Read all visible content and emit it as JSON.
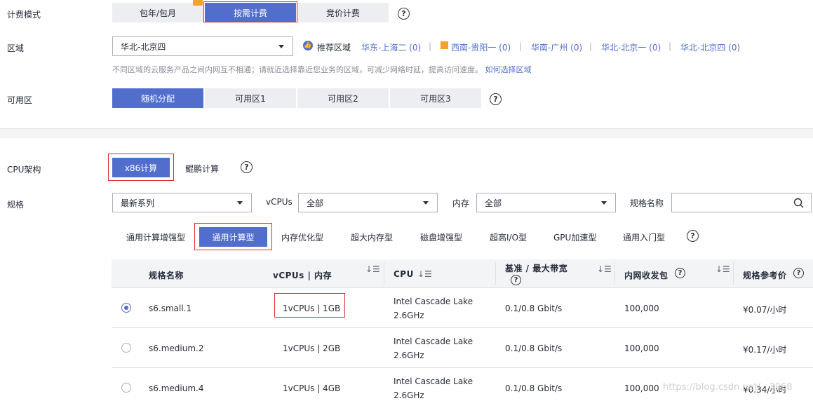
{
  "billing": {
    "label": "计费模式",
    "options": [
      "包年/包月",
      "按需计费",
      "竞价计费"
    ],
    "selected": "按需计费"
  },
  "region": {
    "label": "区域",
    "selected": "华北-北京四",
    "recommend_label": "推荐区域",
    "recommended": [
      "华东-上海二 (0)",
      "西南-贵阳一 (0)",
      "华南-广州 (0)",
      "华北-北京一 (0)",
      "华北-北京四 (0)"
    ],
    "separator": "|",
    "hint": "不同区域的云服务产品之间内网互不相通；请就近选择靠近您业务的区域，可减少网络时延，提高访问速度。",
    "hint_link": "如何选择区域"
  },
  "az": {
    "label": "可用区",
    "options": [
      "随机分配",
      "可用区1",
      "可用区2",
      "可用区3"
    ],
    "selected": "随机分配"
  },
  "cpu_arch": {
    "label": "CPU架构",
    "options": [
      "x86计算",
      "鲲鹏计算"
    ],
    "selected": "x86计算"
  },
  "spec": {
    "label": "规格",
    "series_selected": "最新系列",
    "vcpus_label": "vCPUs",
    "vcpus_selected": "全部",
    "memory_label": "内存",
    "memory_selected": "全部",
    "name_label": "规格名称",
    "name_placeholder": ""
  },
  "type_tabs": [
    "通用计算增强型",
    "通用计算型",
    "内存优化型",
    "超大内存型",
    "磁盘增强型",
    "超高I/O型",
    "GPU加速型",
    "通用入门型"
  ],
  "type_selected": "通用计算型",
  "table": {
    "headers": {
      "name": "规格名称",
      "vcpu_mem": "vCPUs | 内存",
      "cpu": "CPU",
      "bandwidth": "基准 / 最大带宽",
      "pps": "内网收发包",
      "price": "规格参考价"
    },
    "rows": [
      {
        "name": "s6.small.1",
        "vcpu_mem": "1vCPUs | 1GB",
        "cpu_line1": "Intel Cascade Lake",
        "cpu_line2": "2.6GHz",
        "bandwidth": "0.1/0.8 Gbit/s",
        "pps": "100,000",
        "price": "¥0.07/小时",
        "selected": true
      },
      {
        "name": "s6.medium.2",
        "vcpu_mem": "1vCPUs | 2GB",
        "cpu_line1": "Intel Cascade Lake",
        "cpu_line2": "2.6GHz",
        "bandwidth": "0.1/0.8 Gbit/s",
        "pps": "100,000",
        "price": "¥0.17/小时",
        "selected": false
      },
      {
        "name": "s6.medium.4",
        "vcpu_mem": "1vCPUs | 4GB",
        "cpu_line1": "Intel Cascade Lake",
        "cpu_line2": "2.6GHz",
        "bandwidth": "0.1/0.8 Gbit/s",
        "pps": "100,000",
        "price": "¥0.34/小时",
        "selected": false
      }
    ]
  },
  "watermark": "https://blog.csdn.net/...3968",
  "colors": {
    "accent": "#526ecc",
    "highlight_box": "#e02b2b",
    "gift": "#f2a22d"
  }
}
